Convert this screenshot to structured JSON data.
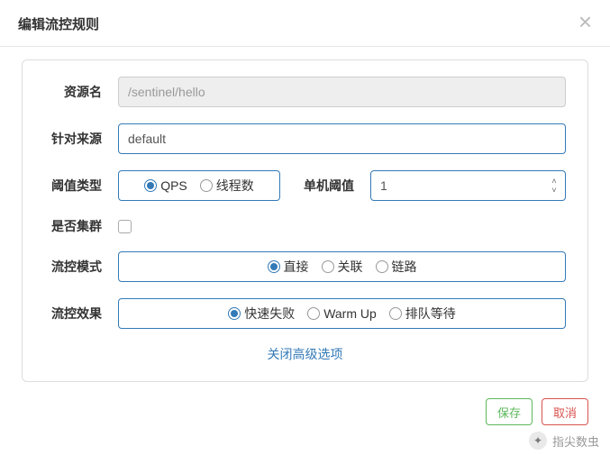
{
  "modal": {
    "title": "编辑流控规则",
    "close": "×"
  },
  "form": {
    "resource": {
      "label": "资源名",
      "value": "/sentinel/hello"
    },
    "source": {
      "label": "针对来源",
      "value": "default"
    },
    "thresholdType": {
      "label": "阈值类型",
      "options": [
        {
          "label": "QPS",
          "selected": true
        },
        {
          "label": "线程数",
          "selected": false
        }
      ]
    },
    "singleThreshold": {
      "label": "单机阈值",
      "value": "1"
    },
    "cluster": {
      "label": "是否集群",
      "checked": false
    },
    "mode": {
      "label": "流控模式",
      "options": [
        {
          "label": "直接",
          "selected": true
        },
        {
          "label": "关联",
          "selected": false
        },
        {
          "label": "链路",
          "selected": false
        }
      ]
    },
    "effect": {
      "label": "流控效果",
      "options": [
        {
          "label": "快速失败",
          "selected": true
        },
        {
          "label": "Warm Up",
          "selected": false
        },
        {
          "label": "排队等待",
          "selected": false
        }
      ]
    },
    "advancedLink": "关闭高级选项"
  },
  "footer": {
    "save": "保存",
    "cancel": "取消"
  },
  "watermark": {
    "text": "指尖数虫"
  }
}
